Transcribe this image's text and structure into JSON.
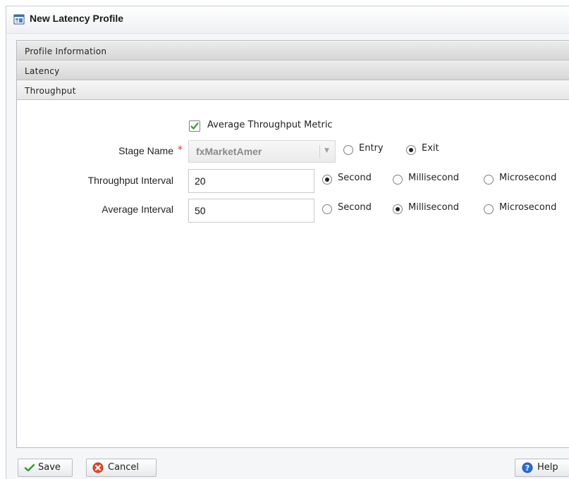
{
  "window": {
    "title": "New Latency Profile",
    "title_icon": "profile-window-icon"
  },
  "accordion": {
    "sections": [
      {
        "label": "Profile Information"
      },
      {
        "label": "Latency"
      },
      {
        "label": "Throughput",
        "expanded": true
      }
    ]
  },
  "throughput": {
    "average_metric": {
      "label": "Average Throughput Metric",
      "checked": true
    },
    "stage": {
      "label": "Stage Name",
      "required_marker": "*",
      "value": "fxMarketAmer",
      "options": [
        {
          "label": "Entry",
          "selected": false
        },
        {
          "label": "Exit",
          "selected": true
        }
      ]
    },
    "throughput_interval": {
      "label": "Throughput Interval",
      "value": "20",
      "units": [
        {
          "label": "Second",
          "selected": true
        },
        {
          "label": "Millisecond",
          "selected": false
        },
        {
          "label": "Microsecond",
          "selected": false
        }
      ]
    },
    "average_interval": {
      "label": "Average Interval",
      "value": "50",
      "units": [
        {
          "label": "Second",
          "selected": false
        },
        {
          "label": "Millisecond",
          "selected": true
        },
        {
          "label": "Microsecond",
          "selected": false
        }
      ]
    }
  },
  "footer": {
    "save_label": "Save",
    "cancel_label": "Cancel",
    "help_label": "Help"
  },
  "colors": {
    "accent_check": "#2d9b2d",
    "required": "#dd3333",
    "cancel_icon": "#e04a2f",
    "help_icon": "#2b6fd6"
  }
}
